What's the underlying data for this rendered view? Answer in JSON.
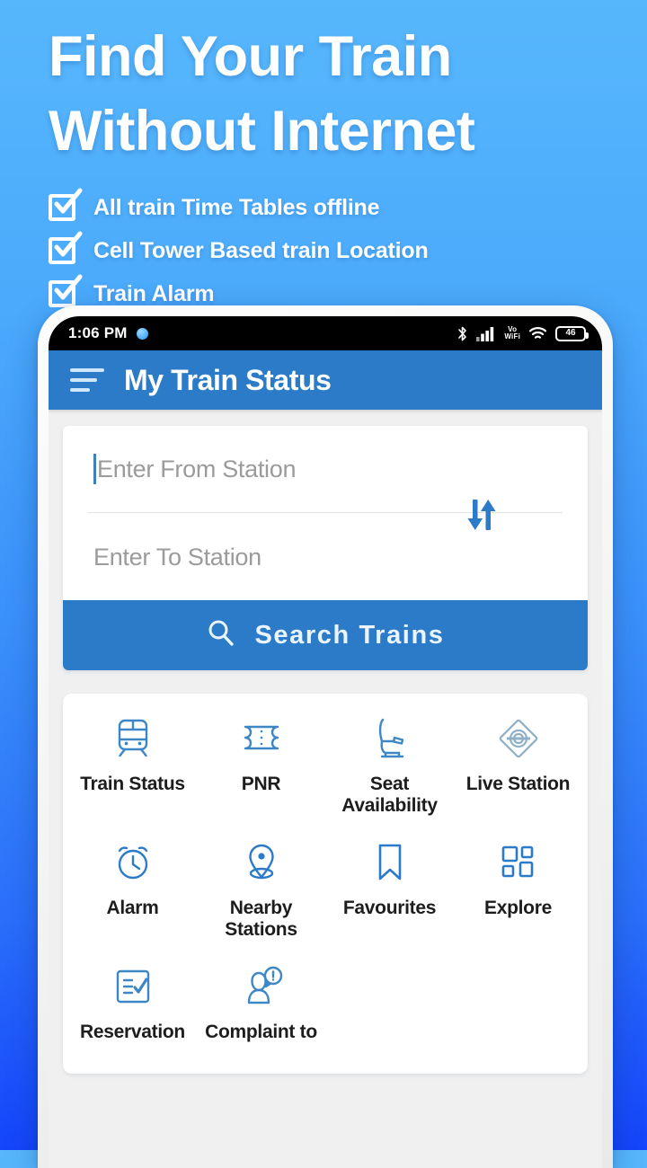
{
  "promo": {
    "headline_line1": "Find Your Train",
    "headline_line2": "Without Internet",
    "bullets": [
      "All train Time Tables offline",
      "Cell Tower Based train Location",
      "Train Alarm"
    ]
  },
  "phone": {
    "status_bar": {
      "time": "1:06 PM",
      "vo_label": "Vo",
      "wifi_label": "WiFi",
      "battery_level": "46"
    },
    "app_bar": {
      "title": "My Train Status"
    },
    "search": {
      "from_placeholder": "Enter From Station",
      "from_value": "",
      "to_placeholder": "Enter To Station",
      "to_value": "",
      "button_label": "Search Trains"
    },
    "features": [
      [
        {
          "label": "Train Status",
          "icon": "train-icon"
        },
        {
          "label": "PNR",
          "icon": "ticket-icon"
        },
        {
          "label": "Seat\nAvailability",
          "icon": "seat-icon"
        },
        {
          "label": "Live Station",
          "icon": "railway-diamond-icon"
        }
      ],
      [
        {
          "label": "Alarm",
          "icon": "alarm-clock-icon"
        },
        {
          "label": "Nearby\nStations",
          "icon": "location-pin-icon"
        },
        {
          "label": "Favourites",
          "icon": "bookmark-icon"
        },
        {
          "label": "Explore",
          "icon": "grid-icon"
        }
      ],
      [
        {
          "label": "Reservation",
          "icon": "checklist-icon"
        },
        {
          "label": "Complaint to",
          "icon": "person-alert-icon"
        }
      ]
    ]
  },
  "colors": {
    "brand_blue": "#2b7bc9",
    "bg_gradient_top": "#57b7fc",
    "bg_gradient_bottom": "#1445fb",
    "icon_blue": "#3d87c6",
    "placeholder_grey": "#9b9b9b"
  }
}
